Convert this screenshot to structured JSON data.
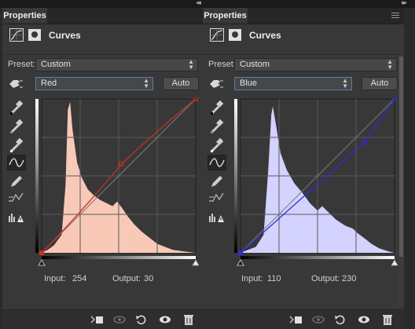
{
  "panels": [
    {
      "tab_label": "Properties",
      "header_title": "Curves",
      "preset_label": "Preset:",
      "preset_value": "Custom",
      "channel_value": "Red",
      "auto_label": "Auto",
      "input_label": "Input:",
      "input_value": "254",
      "output_label": "Output:",
      "output_value": "30",
      "colors": {
        "histogram": "#f7c9b6",
        "curve": "#c8301e",
        "point": "#c8301e"
      },
      "curve_points": [
        [
          0,
          0
        ],
        [
          132,
          147
        ],
        [
          255,
          255
        ]
      ]
    },
    {
      "tab_label": "Properties",
      "header_title": "Curves",
      "preset_label": "Preset:",
      "preset_value": "Custom",
      "channel_value": "Blue",
      "auto_label": "Auto",
      "input_label": "Input:",
      "input_value": "110",
      "output_label": "Output:",
      "output_value": "230",
      "colors": {
        "histogram": "#d4d2ff",
        "curve": "#2d2dd6",
        "point": "#2d2dd6"
      },
      "curve_points": [
        [
          0,
          0
        ],
        [
          205,
          183
        ],
        [
          255,
          255
        ]
      ]
    }
  ],
  "tools": [
    "target-adjust-icon",
    "black-point-eyedropper-icon",
    "gray-point-eyedropper-icon",
    "white-point-eyedropper-icon",
    "curve-points-icon",
    "pencil-icon",
    "smooth-icon",
    "clipping-warning-icon"
  ],
  "bottom_icons": [
    "clip-to-layer-icon",
    "view-previous-icon",
    "reset-icon",
    "visibility-icon",
    "delete-icon"
  ]
}
